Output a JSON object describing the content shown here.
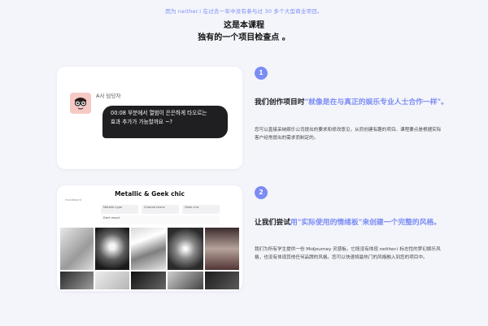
{
  "top_note": "因为 neither.i 在过去一年中没有参与过 30 多个大型商业项目。",
  "heading": {
    "line1": "这是本课程",
    "line2": "独有的一个项目检查点 。"
  },
  "feature1": {
    "step": "1",
    "title_plain": "我们创作项目时",
    "title_accent": "\"就像是在与真正的娱乐专业人士合作一样\"。",
    "desc": "您可以直接采纳娱乐公司提出的要求和修改意见，从而创建有趣的项目。课程要点是根据实际客户经常提出的需求而制定的。",
    "chat": {
      "sender": "A사 담당자",
      "message_line1": "00:08 부분에서 열범이 은은하게 타오르는",
      "message_line2": "효과 추가가 가능할까요 ~?"
    }
  },
  "feature2": {
    "step": "2",
    "title_plain": "让我们尝试",
    "title_accent": "用\"实际使用的情绪板\"来创建一个完整的风格。",
    "desc": "我们为所有学生提供一份 Midjourney 灵感板。它既没有体现 neither.i 标志性的梦幻娱乐风格，也没有体现其他任何品牌的风格。您可以快速将最热门的风格融入到您的项目中。",
    "moodboard": {
      "title": "Metallic & Geek chic",
      "subtitle": "moodboard",
      "tags": [
        "Metallic type",
        "Chrome forms",
        "Geek chic",
        "Dark mood"
      ]
    }
  },
  "colors": {
    "accent": "#7b8cf5",
    "bubble": "#1f1f22",
    "avatar_bg": "#f7c9c4",
    "background": "#f4f5fb"
  }
}
